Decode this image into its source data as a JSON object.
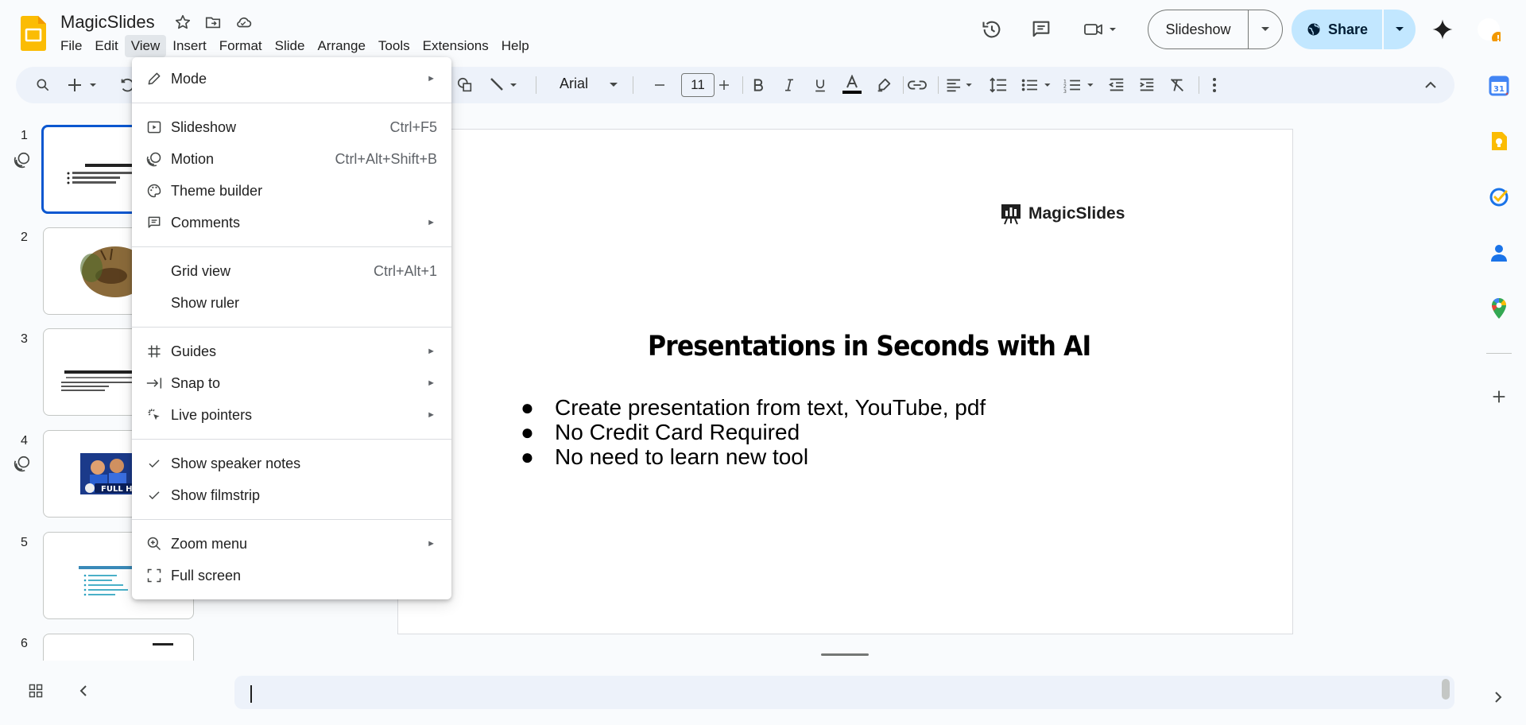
{
  "app": {
    "title": "MagicSlides",
    "brand_color": "#fbbc04",
    "accent_color": "#0b57d0",
    "menus": [
      "File",
      "Edit",
      "View",
      "Insert",
      "Format",
      "Slide",
      "Arrange",
      "Tools",
      "Extensions",
      "Help"
    ],
    "active_menu": "View"
  },
  "header": {
    "slideshow_label": "Slideshow",
    "share_label": "Share"
  },
  "toolbar": {
    "font_name": "Arial",
    "font_size": "11"
  },
  "filmstrip": {
    "numbers": [
      "1",
      "2",
      "3",
      "4",
      "5",
      "6"
    ],
    "selected": "1"
  },
  "slide": {
    "brand_text": "MagicSlides",
    "title": "Presentations in Seconds with AI",
    "bullets": [
      "Create presentation from text, YouTube, pdf",
      "No Credit Card Required",
      "No need to learn new tool"
    ],
    "bullet_char": "●"
  },
  "view_menu": {
    "mode": "Mode",
    "slideshow": {
      "label": "Slideshow",
      "shortcut": "Ctrl+F5"
    },
    "motion": {
      "label": "Motion",
      "shortcut": "Ctrl+Alt+Shift+B"
    },
    "theme_builder": "Theme builder",
    "comments": "Comments",
    "grid_view": {
      "label": "Grid view",
      "shortcut": "Ctrl+Alt+1"
    },
    "show_ruler": "Show ruler",
    "guides": "Guides",
    "snap_to": "Snap to",
    "live_pointers": "Live pointers",
    "show_speaker_notes": "Show speaker notes",
    "show_filmstrip": "Show filmstrip",
    "zoom_menu": "Zoom menu",
    "full_screen": "Full screen",
    "submenu_arrow": "►"
  },
  "side_panel_icons": [
    "calendar-icon",
    "keep-icon",
    "tasks-icon",
    "contacts-icon",
    "maps-icon",
    "add-icon"
  ]
}
